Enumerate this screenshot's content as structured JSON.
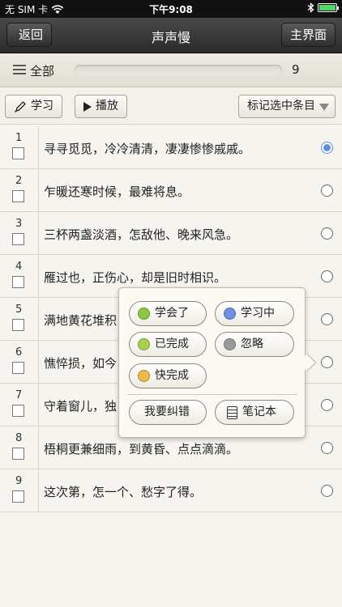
{
  "status_bar": {
    "carrier": "无 SIM 卡",
    "time": "下午9:08",
    "wifi_icon": "wifi-icon",
    "bluetooth_icon": "bluetooth-icon",
    "battery_icon": "battery-icon",
    "battery_level": 1.0
  },
  "nav": {
    "back_label": "返回",
    "title": "声声慢",
    "main_label": "主界面"
  },
  "filter": {
    "menu_icon": "menu-icon",
    "label": "全部",
    "count": "9",
    "progress": 0.0
  },
  "toolbar": {
    "study_label": "学习",
    "study_icon": "pen-icon",
    "play_label": "播放",
    "play_icon": "play-icon",
    "mark_label": "标记选中条目"
  },
  "rows": [
    {
      "num": "1",
      "text": "寻寻觅觅，冷冷清清，凄凄惨惨戚戚。",
      "selected": true
    },
    {
      "num": "2",
      "text": "乍暖还寒时候，最难将息。",
      "selected": false
    },
    {
      "num": "3",
      "text": "三杯两盏淡酒，怎敌他、晚来风急。",
      "selected": false
    },
    {
      "num": "4",
      "text": "雁过也，正伤心，却是旧时相识。",
      "selected": false
    },
    {
      "num": "5",
      "text": "满地黄花堆积",
      "selected": false
    },
    {
      "num": "6",
      "text": "憔悴损，如今",
      "selected": false
    },
    {
      "num": "7",
      "text": "守着窗儿，独",
      "selected": false
    },
    {
      "num": "8",
      "text": "梧桐更兼细雨，到黄昏、点点滴滴。",
      "selected": false
    },
    {
      "num": "9",
      "text": "这次第，怎一个、愁字了得。",
      "selected": false
    }
  ],
  "popup": {
    "learned": {
      "label": "学会了",
      "color": "#8dc63f"
    },
    "studying": {
      "label": "学习中",
      "color": "#6f8fe6"
    },
    "completed": {
      "label": "已完成",
      "color": "#a8d04a"
    },
    "ignore": {
      "label": "忽略",
      "color": "#9a9a9a"
    },
    "almost": {
      "label": "快完成",
      "color": "#f0b84a"
    },
    "report_label": "我要纠错",
    "notebook_label": "笔记本",
    "notebook_icon": "notebook-icon"
  }
}
